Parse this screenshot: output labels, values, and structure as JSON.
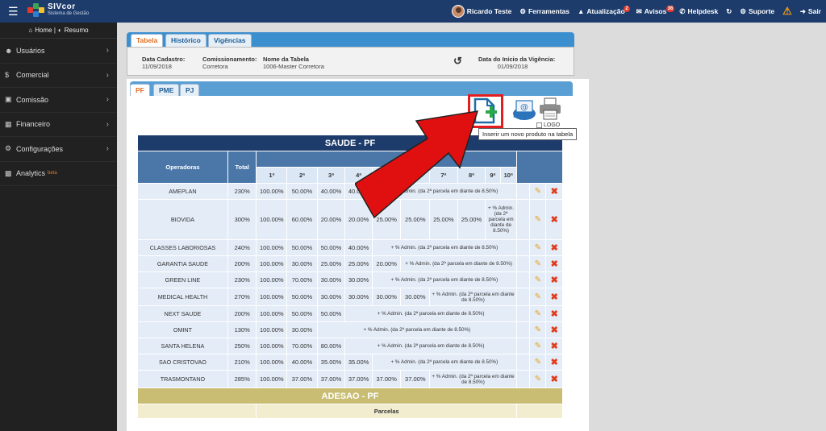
{
  "topbar": {
    "logo_title": "SIVcor",
    "logo_sub": "Sistema de Gestão",
    "user": "Ricardo Teste",
    "items": [
      {
        "label": "Ferramentas",
        "badge": ""
      },
      {
        "label": "Atualização",
        "badge": "2"
      },
      {
        "label": "Avisos",
        "badge": "36"
      },
      {
        "label": "Helpdesk",
        "badge": ""
      }
    ],
    "suporte": "Suporte",
    "sair": "Sair"
  },
  "sidebar": {
    "home": "Home |",
    "resumo": "Resumo",
    "items": [
      {
        "label": "Usuários",
        "icon": "users-icon"
      },
      {
        "label": "Comercial",
        "icon": "dollar-icon"
      },
      {
        "label": "Comissão",
        "icon": "money-icon"
      },
      {
        "label": "Financeiro",
        "icon": "building-icon"
      },
      {
        "label": "Configurações",
        "icon": "gears-icon"
      },
      {
        "label": "Analytics",
        "icon": "chart-icon",
        "suffix": "beta"
      }
    ]
  },
  "outer_tabs": [
    "Tabela",
    "Histórico",
    "Vigências"
  ],
  "info": {
    "data_cadastro_label": "Data Cadastro:",
    "data_cadastro": "11/09/2018",
    "comissionamento_label": "Comissionamento:",
    "comissionamento": "Corretora",
    "nome_label": "Nome da Tabela",
    "nome": "1006-Master Corretora",
    "vigencia_label": "Data do Início da Vigência:",
    "vigencia": "01/09/2018"
  },
  "inner_tabs": [
    "PF",
    "PME",
    "PJ"
  ],
  "toolbar": {
    "logo_label": "LOGO",
    "tooltip": "Inserir um novo produto na tabela"
  },
  "table": {
    "title": "SAUDE - PF",
    "col_operadoras": "Operadoras",
    "col_total": "Total",
    "parcels": [
      "1ª",
      "2ª",
      "3ª",
      "4ª",
      "5ª",
      "6ª",
      "7ª",
      "8ª",
      "9ª",
      "10ª"
    ],
    "note": "+ % Admin. (da 2ª parcela em diante de 8.50%)",
    "rows": [
      {
        "op": "AMEPLAN",
        "total": "230%",
        "vals": [
          "100.00%",
          "50.00%",
          "40.00%",
          "40.00%"
        ]
      },
      {
        "op": "BIOVIDA",
        "total": "300%",
        "vals": [
          "100.00%",
          "60.00%",
          "20.00%",
          "20.00%",
          "25.00%",
          "25.00%",
          "25.00%",
          "25.00%"
        ]
      },
      {
        "op": "CLASSES LABORIOSAS",
        "total": "240%",
        "vals": [
          "100.00%",
          "50.00%",
          "50.00%",
          "40.00%"
        ]
      },
      {
        "op": "GARANTIA SAUDE",
        "total": "200%",
        "vals": [
          "100.00%",
          "30.00%",
          "25.00%",
          "25.00%",
          "20.00%"
        ]
      },
      {
        "op": "GREEN LINE",
        "total": "230%",
        "vals": [
          "100.00%",
          "70.00%",
          "30.00%",
          "30.00%"
        ]
      },
      {
        "op": "MEDICAL HEALTH",
        "total": "270%",
        "vals": [
          "100.00%",
          "50.00%",
          "30.00%",
          "30.00%",
          "30.00%",
          "30.00%"
        ]
      },
      {
        "op": "NEXT SAUDE",
        "total": "200%",
        "vals": [
          "100.00%",
          "50.00%",
          "50.00%"
        ]
      },
      {
        "op": "OMINT",
        "total": "130%",
        "vals": [
          "100.00%",
          "30.00%"
        ]
      },
      {
        "op": "SANTA HELENA",
        "total": "250%",
        "vals": [
          "100.00%",
          "70.00%",
          "80.00%"
        ]
      },
      {
        "op": "SAO CRISTOVAO",
        "total": "210%",
        "vals": [
          "100.00%",
          "40.00%",
          "35.00%",
          "35.00%"
        ]
      },
      {
        "op": "TRASMONTANO",
        "total": "285%",
        "vals": [
          "100.00%",
          "37.00%",
          "37.00%",
          "37.00%",
          "37.00%",
          "37.00%"
        ]
      }
    ],
    "section2_title": "ADESAO - PF",
    "section2_parcelas": "Parcelas"
  }
}
